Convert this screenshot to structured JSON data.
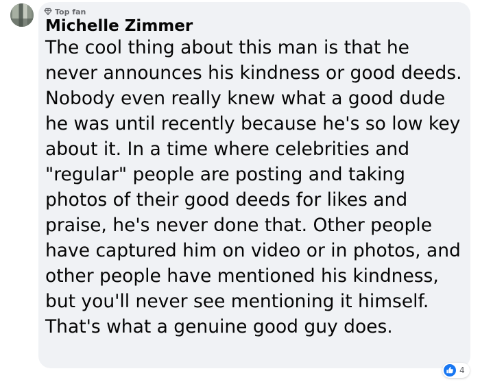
{
  "comment": {
    "badge": {
      "icon": "diamond-icon",
      "label": "Top fan"
    },
    "author": "Michelle Zimmer",
    "avatar": "avatar-image",
    "text": "The cool thing about this man is that he never announces his kindness or good deeds. Nobody even really knew what a good dude he was until recently because he's so low key about it. In a time where celebrities and \"regular\" people are posting and taking photos of their good deeds for likes and praise, he's never done that. Other people have captured him on video or in photos, and other people have mentioned his kindness, but you'll never see mentioning it himself. That's what a genuine good guy does.",
    "reactions": {
      "icon": "like-icon",
      "count": "4"
    }
  },
  "colors": {
    "bubble_background": "#f0f2f5",
    "text": "#050505",
    "secondary_text": "#65676b",
    "like_blue": "#1877f2"
  }
}
